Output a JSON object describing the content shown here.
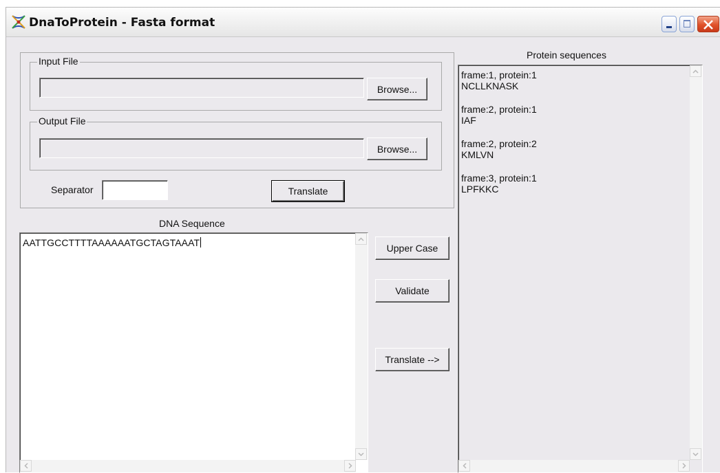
{
  "window": {
    "title": "DnaToProtein - Fasta format"
  },
  "input_file": {
    "legend": "Input File",
    "value": "",
    "browse_label": "Browse..."
  },
  "output_file": {
    "legend": "Output File",
    "value": "",
    "browse_label": "Browse..."
  },
  "separator": {
    "label": "Separator",
    "value": ""
  },
  "translate_top_label": "Translate",
  "dna": {
    "heading": "DNA Sequence",
    "sequence": "AATTGCCTTTTAAAAAATGCTAGTAAAT"
  },
  "actions": {
    "upper_case_label": "Upper Case",
    "validate_label": "Validate",
    "translate_arrow_label": "Translate -->"
  },
  "protein": {
    "heading": "Protein sequences",
    "entries": [
      {
        "header": "frame:1, protein:1",
        "sequence": "NCLLKNASK"
      },
      {
        "header": "frame:2, protein:1",
        "sequence": "IAF"
      },
      {
        "header": "frame:2, protein:2",
        "sequence": "KMLVN"
      },
      {
        "header": "frame:3, protein:1",
        "sequence": "LPFKKC"
      }
    ]
  },
  "icons": {
    "app": "dna-app-icon",
    "minimize": "minimize-icon",
    "maximize": "maximize-icon",
    "close": "close-icon"
  }
}
